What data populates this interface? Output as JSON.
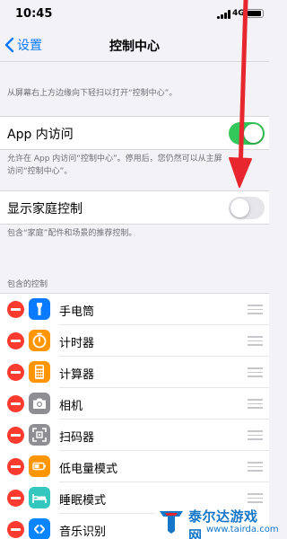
{
  "status_bar": {
    "time": "10:45",
    "network": "4G"
  },
  "nav": {
    "back_label": "设置",
    "title": "控制中心"
  },
  "intro_footnote": "从屏幕右上方边缘向下轻扫以打开“控制中心”。",
  "in_app_access": {
    "label": "App 内访问",
    "enabled": true,
    "footnote_line1": "允许在 App 内访问“控制中心”。停用后，您仍然可以从主屏",
    "footnote_line2": "访问“控制中心”。"
  },
  "home_controls": {
    "label": "显示家庭控制",
    "enabled": false,
    "footnote": "包含“家庭”配件和场景的推荐控制。"
  },
  "included_controls": {
    "header": "包含的控制",
    "items": [
      {
        "label": "手电筒",
        "icon": "flashlight-icon",
        "color": "#0a7aff"
      },
      {
        "label": "计时器",
        "icon": "timer-icon",
        "color": "#ff9500"
      },
      {
        "label": "计算器",
        "icon": "calculator-icon",
        "color": "#ff9500"
      },
      {
        "label": "相机",
        "icon": "camera-icon",
        "color": "#8e8e93"
      },
      {
        "label": "扫码器",
        "icon": "qr-scanner-icon",
        "color": "#8e8e93"
      },
      {
        "label": "低电量模式",
        "icon": "low-power-battery-icon",
        "color": "#ff9500"
      },
      {
        "label": "睡眠模式",
        "icon": "bed-icon",
        "color": "#34c7be"
      },
      {
        "label": "音乐识别",
        "icon": "shazam-icon",
        "color": "#0a84ff"
      }
    ]
  },
  "colors": {
    "accent": "#0a7aff",
    "toggle_on": "#34c759",
    "delete_red": "#ff3b30",
    "annotation_arrow": "#e8262d"
  },
  "watermark": {
    "title": "泰尔达游戏网",
    "url": "www.tairda.com"
  }
}
